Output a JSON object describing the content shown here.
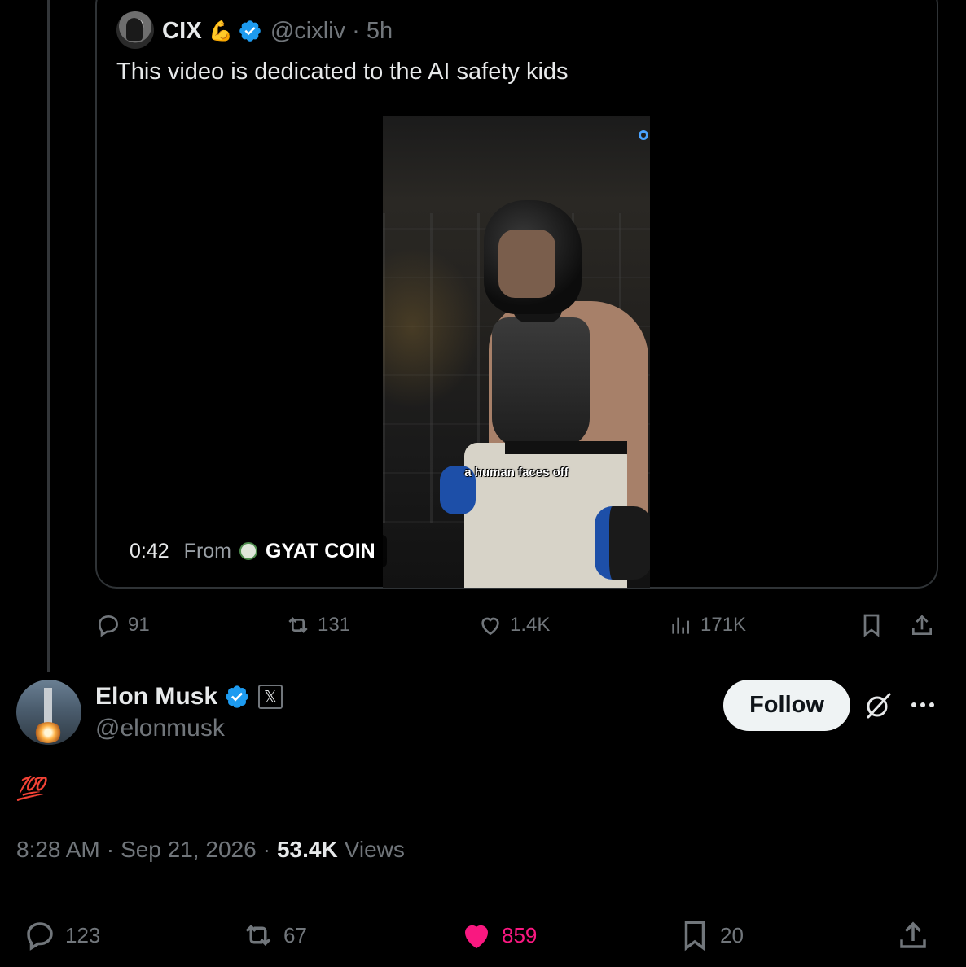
{
  "quoted_post": {
    "name": "CIX",
    "emoji": "💪",
    "handle_time": "@cixliv · 5h",
    "text": "This video is dedicated to the AI safety kids",
    "video": {
      "caption": "a human faces off",
      "duration": "0:42",
      "from_label": "From",
      "source": "GYAT COIN"
    },
    "actions": {
      "replies": "91",
      "reposts": "131",
      "likes": "1.4K",
      "views": "171K"
    }
  },
  "post": {
    "name": "Elon Musk",
    "x_badge": "𝕏",
    "handle": "@elonmusk",
    "follow_label": "Follow",
    "body": "💯",
    "time": "8:28 AM",
    "date": "Sep 21, 2026",
    "views_count": "53.4K",
    "views_label": "Views",
    "separator": "·",
    "actions": {
      "replies": "123",
      "reposts": "67",
      "likes": "859",
      "bookmarks": "20"
    }
  },
  "colors": {
    "background": "#000000",
    "text": "#e7e9ea",
    "muted": "#71767b",
    "verified": "#1d9bf0",
    "like": "#f91880"
  },
  "icons": [
    "reply-icon",
    "repost-icon",
    "like-icon",
    "views-icon",
    "bookmark-icon",
    "share-icon",
    "verified-badge-icon",
    "grok-icon",
    "more-icon"
  ]
}
